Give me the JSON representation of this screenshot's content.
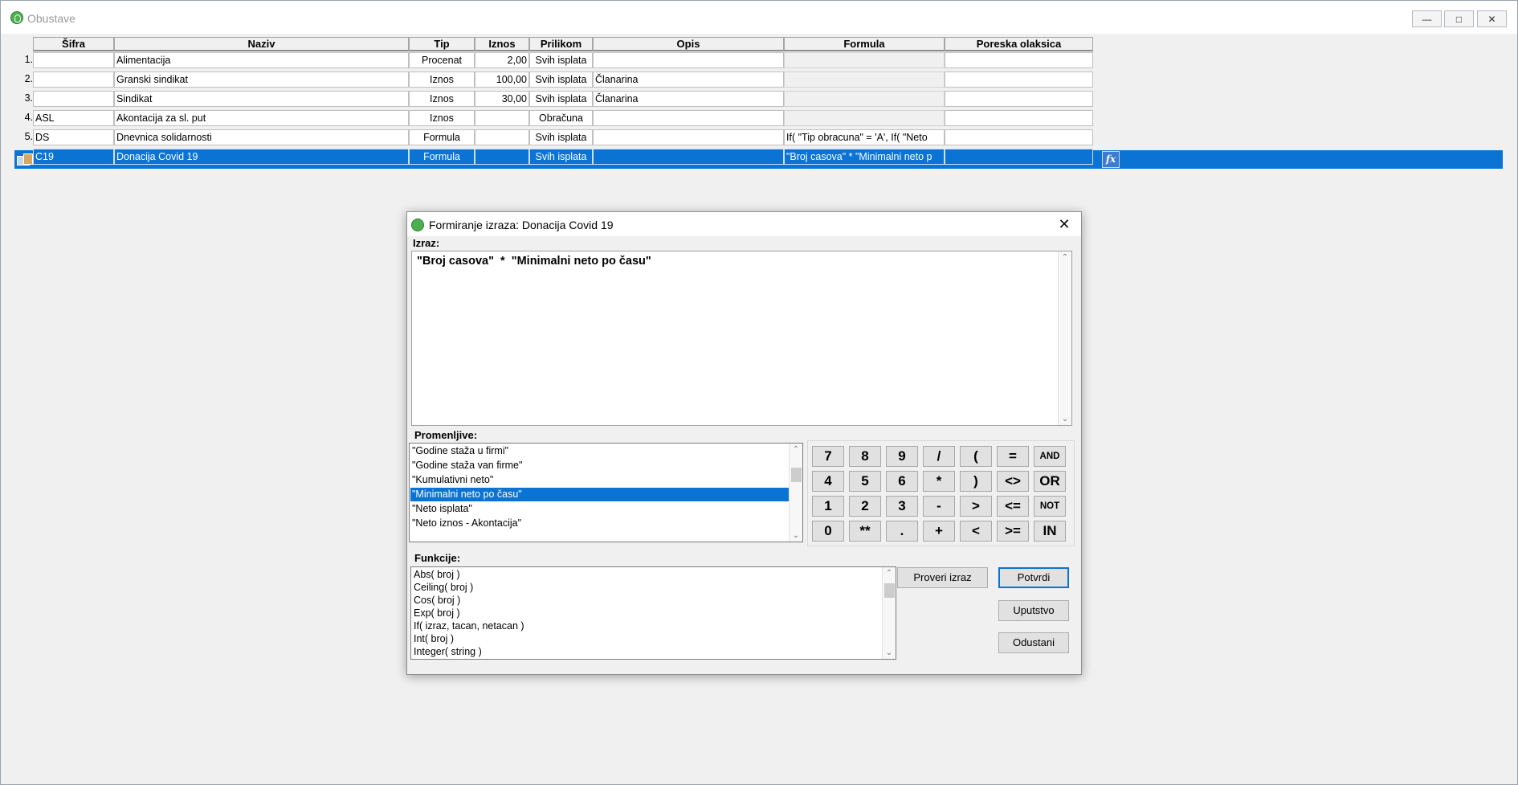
{
  "window": {
    "title": "Obustave",
    "minimize": "—",
    "maximize": "□",
    "close": "✕"
  },
  "grid": {
    "headers": [
      "Šifra",
      "Naziv",
      "Tip",
      "Iznos",
      "Prilikom",
      "Opis",
      "Formula",
      "Poreska olaksica"
    ],
    "rows": [
      {
        "num": "1.",
        "sifra": "",
        "naziv": "Alimentacija",
        "tip": "Procenat",
        "iznos": "2,00",
        "prilikom": "Svih isplata",
        "opis": "",
        "formula": "",
        "poreska": ""
      },
      {
        "num": "2.",
        "sifra": "",
        "naziv": "Granski sindikat",
        "tip": "Iznos",
        "iznos": "100,00",
        "prilikom": "Svih isplata",
        "opis": "Članarina",
        "formula": "",
        "poreska": ""
      },
      {
        "num": "3.",
        "sifra": "",
        "naziv": "Sindikat",
        "tip": "Iznos",
        "iznos": "30,00",
        "prilikom": "Svih isplata",
        "opis": "Članarina",
        "formula": "",
        "poreska": ""
      },
      {
        "num": "4.",
        "sifra": "ASL",
        "naziv": "Akontacija za sl. put",
        "tip": "Iznos",
        "iznos": "",
        "prilikom": "Obračuna",
        "opis": "",
        "formula": "",
        "poreska": ""
      },
      {
        "num": "5.",
        "sifra": "DS",
        "naziv": "Dnevnica solidarnosti",
        "tip": "Formula",
        "iznos": "",
        "prilikom": "Svih isplata",
        "opis": "",
        "formula": "If(  \"Tip obracuna\" = 'A', If(  \"Neto",
        "poreska": ""
      },
      {
        "num": "",
        "sifra": "C19",
        "naziv": "Donacija Covid 19",
        "tip": "Formula",
        "iznos": "",
        "prilikom": "Svih isplata",
        "opis": "",
        "formula": "\"Broj casova\"  *  \"Minimalni neto p",
        "poreska": ""
      }
    ],
    "fx_label": "fx"
  },
  "dialog": {
    "title": "Formiranje izraza: Donacija Covid 19",
    "close": "✕",
    "izraz_label": "Izraz:",
    "expression": "\"Broj casova\"  *  \"Minimalni neto po času\"",
    "promenljive_label": "Promenljive:",
    "variables": [
      "\"Godine staža u firmi\"",
      "\"Godine staža van firme\"",
      "\"Kumulativni neto\"",
      "\"Minimalni neto po času\"",
      "\"Neto isplata\"",
      "\"Neto iznos - Akontacija\""
    ],
    "selected_variable_index": 3,
    "keypad": [
      [
        "7",
        "8",
        "9",
        "/",
        "(",
        "=",
        "AND"
      ],
      [
        "4",
        "5",
        "6",
        "*",
        ")",
        "<>",
        "OR"
      ],
      [
        "1",
        "2",
        "3",
        "-",
        ">",
        "<=",
        "NOT"
      ],
      [
        "0",
        "**",
        ".",
        "+",
        "<",
        ">=",
        "IN"
      ]
    ],
    "funkcije_label": "Funkcije:",
    "functions": [
      "Abs( broj )",
      "Ceiling( broj )",
      "Cos( broj )",
      "Exp( broj )",
      "If( izraz, tacan, netacan )",
      "Int( broj )",
      "Integer( string )"
    ],
    "buttons": {
      "proveri": "Proveri izraz",
      "potvrdi": "Potvrdi",
      "uputstvo": "Uputstvo",
      "odustani": "Odustani"
    }
  }
}
